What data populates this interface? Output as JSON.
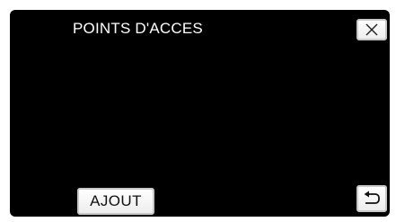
{
  "screen": {
    "title": "POINTS D'ACCES"
  },
  "buttons": {
    "close": {
      "icon": "close-icon"
    },
    "add": {
      "label": "AJOUT"
    },
    "back": {
      "icon": "return-arrow-icon"
    }
  },
  "colors": {
    "background": "#000000",
    "text": "#ffffff",
    "button_face": "#ffffff",
    "button_border": "#c8c8c8",
    "button_text": "#111111"
  }
}
